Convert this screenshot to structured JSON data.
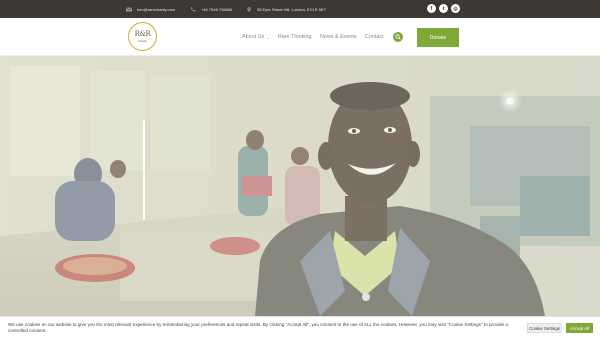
{
  "topbar": {
    "email": "tom@rarecharity.com",
    "phone": "+44 7546 798836",
    "address": "35 Eyre Street Hill, London, EC1R 5ET",
    "social": [
      {
        "name": "facebook-icon",
        "glyph": "f"
      },
      {
        "name": "twitter-icon",
        "glyph": "t"
      },
      {
        "name": "instagram-icon",
        "glyph": "◎"
      }
    ]
  },
  "header": {
    "logo_mark": "R&R",
    "logo_sub": "charity",
    "nav": [
      {
        "label": "About Us",
        "has_dropdown": true
      },
      {
        "label": "Rare Thinking",
        "has_dropdown": false
      },
      {
        "label": "News & Events",
        "has_dropdown": false
      },
      {
        "label": "Contact",
        "has_dropdown": false
      }
    ],
    "donate_label": "Donate"
  },
  "cookie": {
    "text": "We use cookies on our website to give you the most relevant experience by remembering your preferences and repeat visits. By clicking “Accept All”, you consent to the use of ALL the cookies. However, you may visit \"Cookie Settings\" to provide a controlled consent.",
    "settings_label": "Cookie Settings",
    "accept_label": "Accept All"
  },
  "colors": {
    "topbar_bg": "#3d3835",
    "accent_green": "#7fa838",
    "logo_gold": "#c9b233"
  }
}
